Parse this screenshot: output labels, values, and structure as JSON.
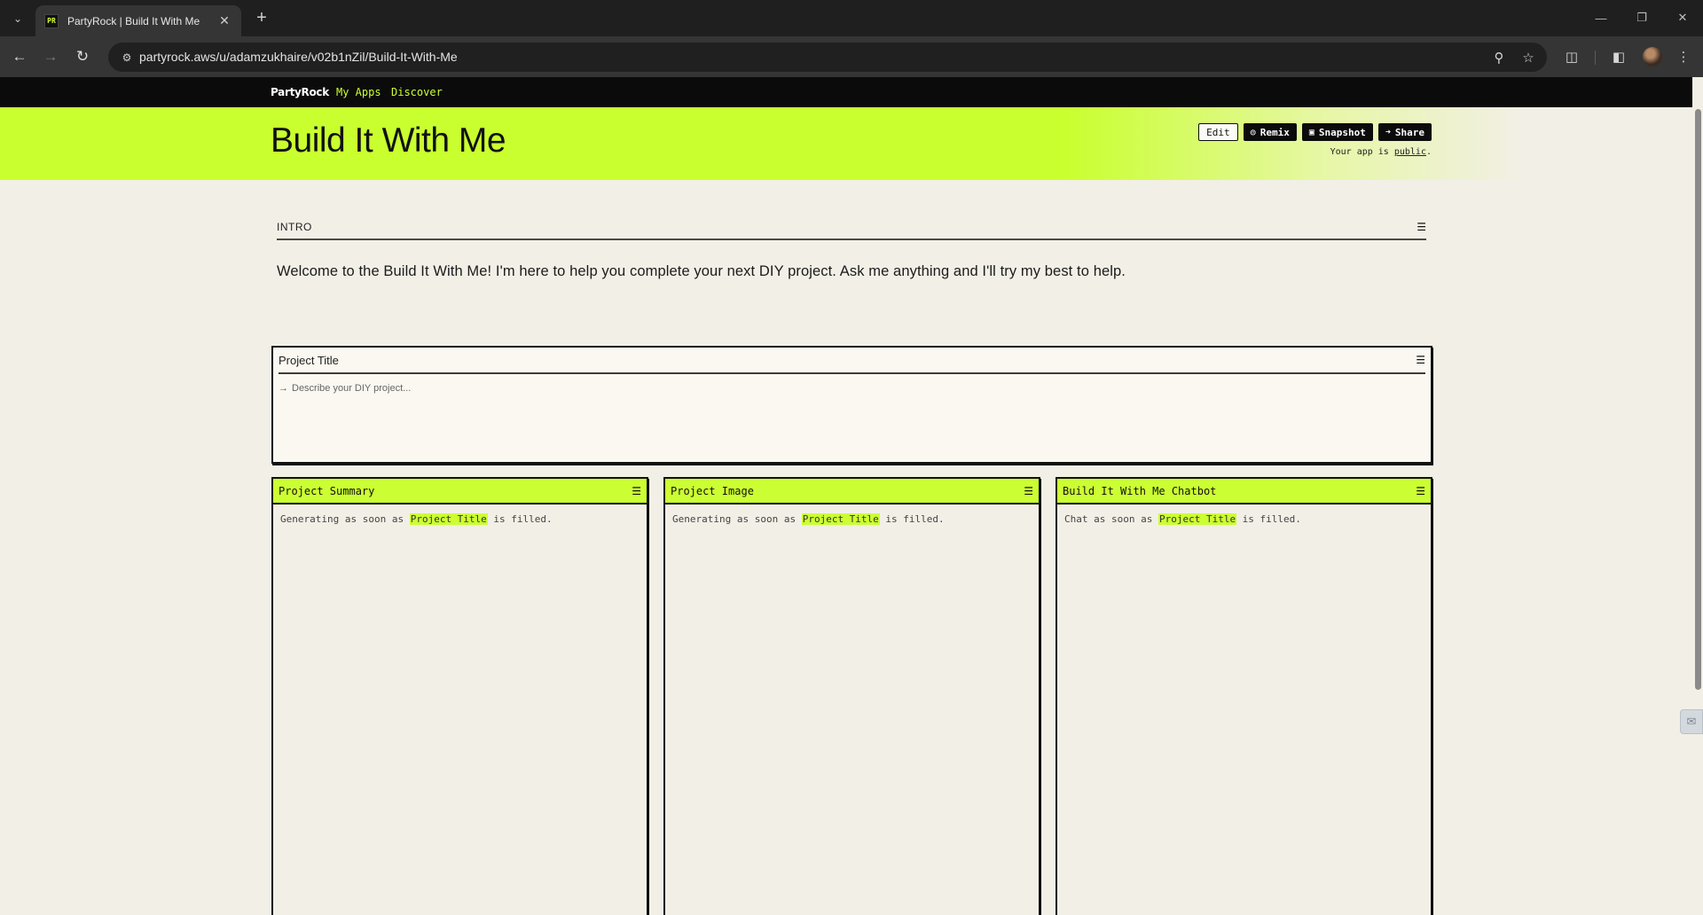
{
  "browser": {
    "tab_title": "PartyRock | Build It With Me",
    "favicon_text": "PR",
    "url": "partyrock.aws/u/adamzukhaire/v02b1nZil/Build-It-With-Me"
  },
  "nav": {
    "brand": "PartyRock",
    "links": [
      "My Apps",
      "Discover"
    ]
  },
  "hero": {
    "title": "Build It With Me",
    "buttons": {
      "edit": "Edit",
      "remix": "Remix",
      "snapshot": "Snapshot",
      "share": "Share"
    },
    "public_prefix": "Your app is ",
    "public_link": "public",
    "public_suffix": "."
  },
  "intro": {
    "label": "INTRO",
    "text": "Welcome to the Build It With Me! I'm here to help you complete your next DIY project. Ask me anything and I'll try my best to help."
  },
  "input_widget": {
    "label": "Project Title",
    "placeholder": "Describe your DIY project..."
  },
  "widgets": [
    {
      "title": "Project Summary",
      "pre": "Generating as soon as ",
      "ref": "Project Title",
      "post": " is filled."
    },
    {
      "title": "Project Image",
      "pre": "Generating as soon as ",
      "ref": "Project Title",
      "post": " is filled."
    },
    {
      "title": "Build It With Me Chatbot",
      "pre": "Chat as soon as ",
      "ref": "Project Title",
      "post": " is filled."
    }
  ],
  "colors": {
    "accent": "#ccff33",
    "background": "#f2efe6",
    "nav": "#0b0b0b"
  },
  "icons": [
    "tab-list-icon",
    "close-icon",
    "plus-icon",
    "back-icon",
    "forward-icon",
    "reload-icon",
    "site-info-icon",
    "zoom-icon",
    "bookmark-star-icon",
    "extensions-icon",
    "side-panel-icon",
    "menu-icon",
    "settings-sliders-icon",
    "eye-icon",
    "camera-icon",
    "arrow-right-icon"
  ]
}
